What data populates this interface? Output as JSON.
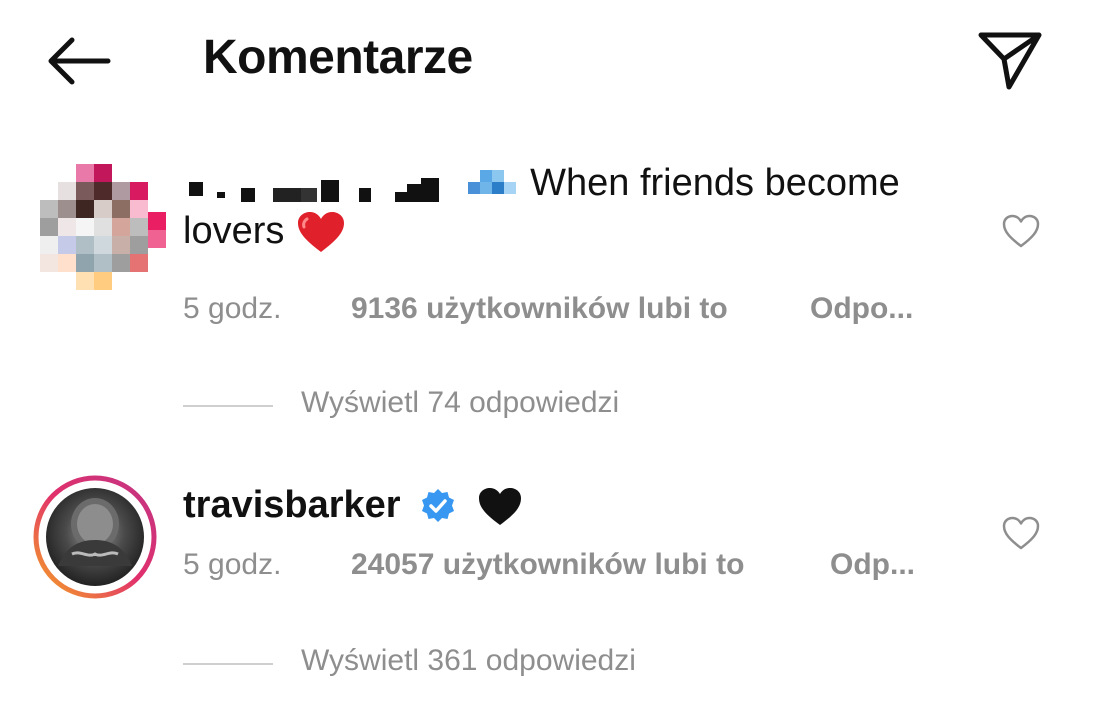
{
  "header": {
    "title": "Komentarze",
    "back_icon": "arrow-left-icon",
    "share_icon": "paper-plane-icon"
  },
  "comments": [
    {
      "username": "",
      "text_line1": "When friends become",
      "text_line2": "lovers",
      "emoji_blue": "blue-pixel-emoji",
      "emoji_heart": "red-heart-icon",
      "time": "5 godz.",
      "likes": "9136 użytkowników lubi to",
      "reply": "Odpo...",
      "view_replies": "Wyświetl 74 odpowiedzi",
      "avatar_icon": "pixelated-avatar"
    },
    {
      "username": "travisbarker",
      "verified_icon": "verified-badge-icon",
      "emoji": "black-heart-icon",
      "time": "5 godz.",
      "likes": "24057 użytkowników lubi to",
      "reply": "Odp...",
      "view_replies": "Wyświetl 361 odpowiedzi",
      "avatar_icon": "story-ring-avatar"
    }
  ],
  "colors": {
    "text": "#111111",
    "meta": "#8e8e8e",
    "verified": "#3897f0",
    "heart_red": "#e0202a",
    "ring_start": "#f5a623",
    "ring_end": "#c13584"
  }
}
